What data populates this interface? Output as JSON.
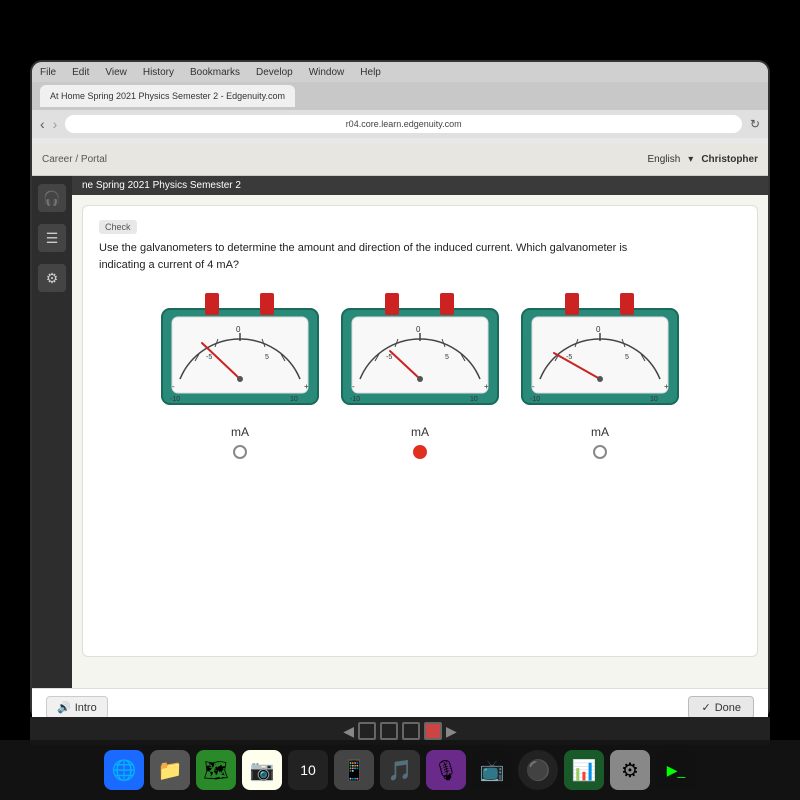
{
  "browser": {
    "url": "r04.core.learn.edgenuity.com",
    "tab_label": "At Home Spring 2021 Physics Semester 2 - Edgenuity.com",
    "menu_items": [
      "File",
      "Edit",
      "View",
      "History",
      "Bookmarks",
      "Develop",
      "Window",
      "Help"
    ]
  },
  "topnav": {
    "language": "English",
    "username": "Christopher",
    "breadcrumb": "Career / Portal"
  },
  "course": {
    "title": "ne Spring 2021 Physics Semester 2"
  },
  "question": {
    "check_label": "Check",
    "text_line1": "Use the galvanometers to determine the amount and direction of the induced current. Which galvanometer is",
    "text_line2": "indicating a current of 4 mA?"
  },
  "galvanometers": [
    {
      "id": 1,
      "label": "mA",
      "selected": false,
      "needle_angle": -40,
      "description": "needle pointing left of center"
    },
    {
      "id": 2,
      "label": "mA",
      "selected": true,
      "needle_angle": -25,
      "description": "needle pointing slightly left"
    },
    {
      "id": 3,
      "label": "mA",
      "selected": false,
      "needle_angle": -50,
      "description": "needle pointing further left"
    }
  ],
  "buttons": {
    "intro_label": "Intro",
    "done_label": "Done"
  },
  "dock": {
    "icons": [
      "🌐",
      "📁",
      "🗺",
      "📷",
      "🎵",
      "🎙",
      "📺",
      "⚫",
      "📊",
      "🛠",
      "⚙",
      "🔴"
    ]
  }
}
